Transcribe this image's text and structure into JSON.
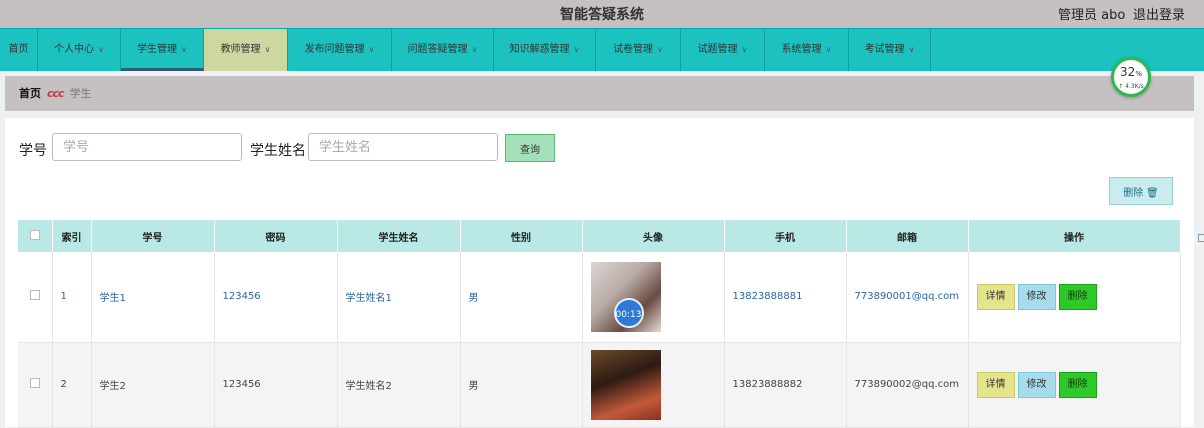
{
  "header": {
    "title": "智能答疑系统",
    "user": "管理员 abo",
    "logout": "退出登录"
  },
  "nav": {
    "items": [
      {
        "label": "首页"
      },
      {
        "label": "个人中心"
      },
      {
        "label": "学生管理"
      },
      {
        "label": "教师管理"
      },
      {
        "label": "发布问题管理"
      },
      {
        "label": "问题答疑管理"
      },
      {
        "label": "知识解惑管理"
      },
      {
        "label": "试卷管理"
      },
      {
        "label": "试题管理"
      },
      {
        "label": "系统管理"
      },
      {
        "label": "考试管理"
      }
    ]
  },
  "breadcrumb": {
    "home": "首页",
    "current": "学生"
  },
  "speed_widget": {
    "percent": "32",
    "unit": "%",
    "rate": "↑ 4.3K/s"
  },
  "search": {
    "id_label": "学号",
    "id_placeholder": "学号",
    "name_label": "学生姓名",
    "name_placeholder": "学生姓名",
    "query_button": "查询"
  },
  "toolbar": {
    "bulk_delete": "删除"
  },
  "table": {
    "columns": [
      "索引",
      "学号",
      "密码",
      "学生姓名",
      "性别",
      "头像",
      "手机",
      "邮箱",
      "操作"
    ],
    "rows": [
      {
        "index": "1",
        "student_id": "学生1",
        "password": "123456",
        "name": "学生姓名1",
        "gender": "男",
        "phone": "13823888881",
        "email": "773890001@qq.com",
        "timer": "00:13"
      },
      {
        "index": "2",
        "student_id": "学生2",
        "password": "123456",
        "name": "学生姓名2",
        "gender": "男",
        "phone": "13823888882",
        "email": "773890002@qq.com"
      }
    ],
    "actions": {
      "detail": "详情",
      "edit": "修改",
      "delete": "删除"
    }
  }
}
